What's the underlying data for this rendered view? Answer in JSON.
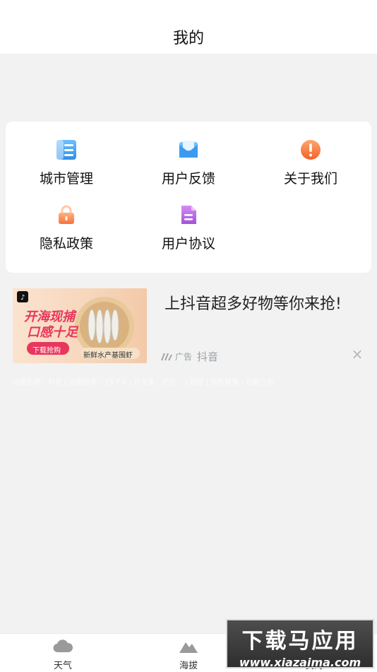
{
  "header": {
    "title": "我的"
  },
  "menu": {
    "items": [
      {
        "label": "城市管理",
        "icon": "list-icon"
      },
      {
        "label": "用户反馈",
        "icon": "mail-icon"
      },
      {
        "label": "关于我们",
        "icon": "alert-icon"
      },
      {
        "label": "隐私政策",
        "icon": "lock-icon"
      },
      {
        "label": "用户协议",
        "icon": "document-icon"
      }
    ]
  },
  "ad": {
    "title": "上抖音超多好物等你来抢!",
    "tag": "广告",
    "source": "抖音",
    "image": {
      "headline1": "开海现捕",
      "headline2": "口感十足",
      "button": "下载抢购",
      "caption": "新鲜水产基围虾"
    },
    "fine_print": "应用名称：抖音 | 应用版本：33.7.0 | 开发者：北京... | 权限 | 隐私政策 | 功能介绍"
  },
  "tabbar": {
    "items": [
      {
        "label": "天气",
        "icon": "cloud-icon"
      },
      {
        "label": "海拔",
        "icon": "mountain-icon"
      },
      {
        "label": "我的",
        "icon": "person-icon"
      }
    ]
  },
  "watermark": {
    "line1": "下载马应用",
    "line2": "www.xiazaima.com"
  },
  "colors": {
    "accent_blue": "#2f97ee",
    "alert_orange": "#f37f3d",
    "purple": "#b866e0"
  }
}
